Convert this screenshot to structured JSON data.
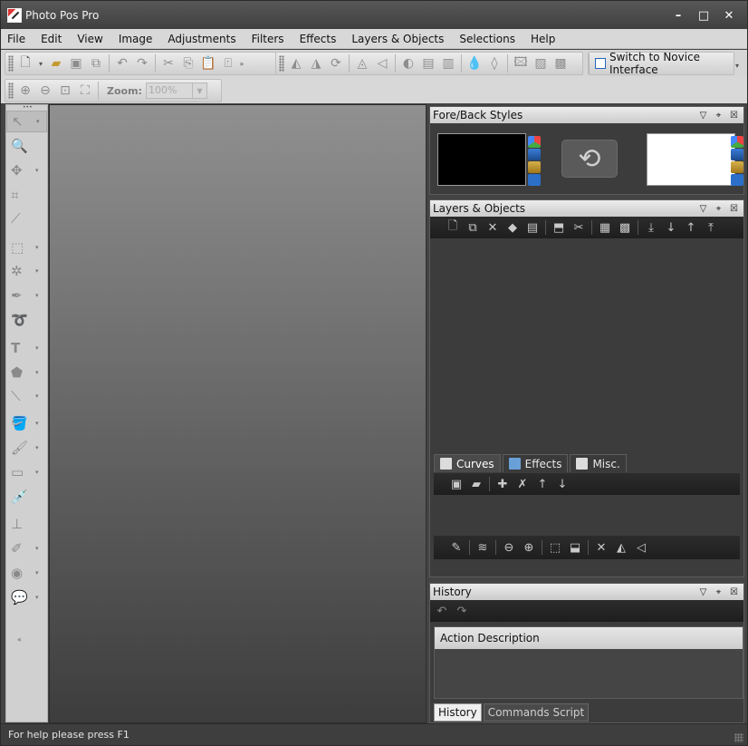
{
  "window": {
    "title": "Photo Pos Pro",
    "controls": [
      "–",
      "□",
      "✕"
    ]
  },
  "menu": [
    "File",
    "Edit",
    "View",
    "Image",
    "Adjustments",
    "Filters",
    "Effects",
    "Layers & Objects",
    "Selections",
    "Help"
  ],
  "toolbar": {
    "novice_button": "Switch to Novice Interface",
    "zoom_label": "Zoom:",
    "zoom_value": "100%"
  },
  "panels": {
    "fore_back": {
      "title": "Fore/Back Styles",
      "fore_color": "#000000",
      "back_color": "#ffffff"
    },
    "layers": {
      "title": "Layers & Objects",
      "tabs": [
        "Curves",
        "Effects",
        "Misc."
      ]
    },
    "history": {
      "title": "History",
      "column_header": "Action Description",
      "tabs": [
        "History",
        "Commands Script"
      ]
    }
  },
  "status": {
    "help_text": "For help please press F1"
  },
  "colors": {
    "canvas_top": "#909090",
    "canvas_bottom": "#3d3d3d",
    "panel_dark": "#3c3c3c"
  }
}
